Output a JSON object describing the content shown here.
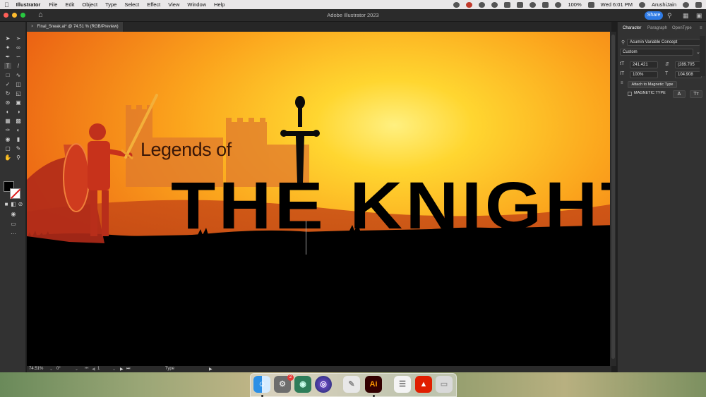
{
  "menubar": {
    "app_name": "Illustrator",
    "items": [
      "File",
      "Edit",
      "Object",
      "Type",
      "Select",
      "Effect",
      "View",
      "Window",
      "Help"
    ],
    "battery": "100%",
    "datetime": "Wed 6:01 PM",
    "user": "ArushiJain"
  },
  "titlebar": {
    "app_title": "Adobe Illustrator 2023",
    "share_label": "Share"
  },
  "document": {
    "tab_label": "Final_Sneak.ai* @ 74.51 % (RGB/Preview)",
    "close_glyph": "×"
  },
  "artwork": {
    "subtitle": "Legends of",
    "title": "THE KNIGHT",
    "colors": {
      "sky_top": "#e85a10",
      "sky_glow": "#ffe14a",
      "silhouette": "#000000",
      "knight": "#c0301c"
    }
  },
  "statusbar": {
    "zoom": "74.51%",
    "rotation": "0°",
    "artboard": "1",
    "tool": "Type"
  },
  "panel": {
    "tabs": [
      "Character",
      "Paragraph",
      "OpenType"
    ],
    "font_family": "Acumin Variable Concept",
    "font_style": "Custom",
    "font_size": "241.421",
    "leading": "(289.705",
    "vertical_scale": "100%",
    "horizontal_scale": "104.908",
    "attach_label": "Attach to Magnetic Type",
    "magnetic_label": "MAGNETIC TYPE"
  },
  "dock": {
    "badge": "2",
    "illustrator_label": "Ai"
  }
}
